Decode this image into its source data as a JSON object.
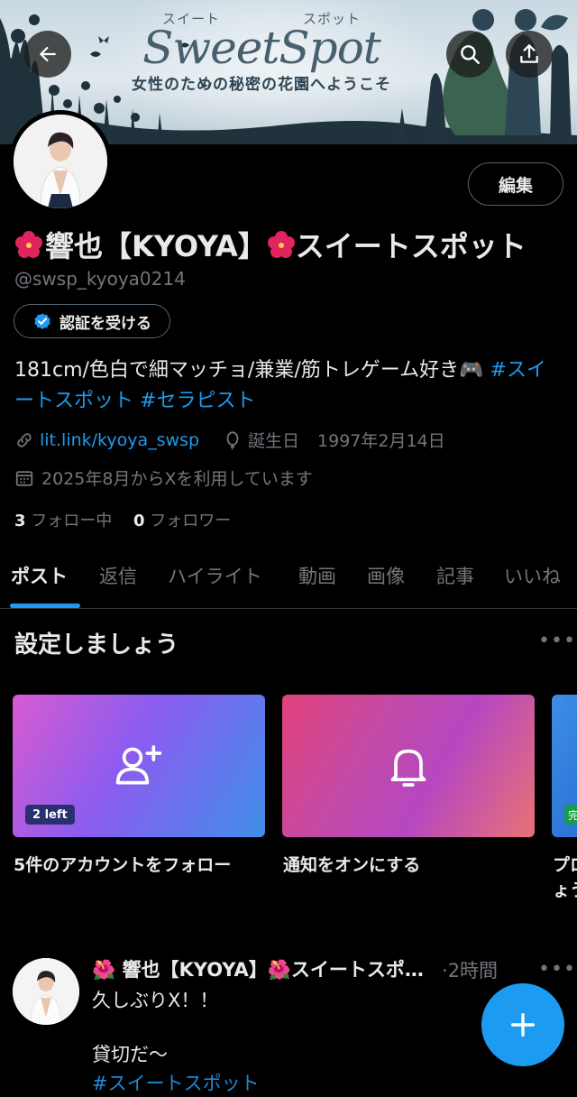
{
  "banner": {
    "logo_kana_left": "スイート",
    "logo_kana_right": "スポット",
    "logo_main": "SweetSpot",
    "tagline": "女性のための秘密の花園へようこそ"
  },
  "nav": {
    "back_icon": "arrow-left-icon",
    "search_icon": "search-icon",
    "share_icon": "share-upload-icon"
  },
  "profile": {
    "edit_label": "編集",
    "name_emoji": "🌺",
    "name_text": "響也【KYOYA】",
    "name_suffix": "スイートスポット",
    "handle": "@swsp_kyoya0214",
    "verify_label": "認証を受ける",
    "bio_text": "181cm/色白で細マッチョ/兼業/筋トレゲーム好き🎮 ",
    "bio_tag1": "#スイートスポット",
    "bio_tag2": "#セラピスト",
    "link": "lit.link/kyoya_swsp",
    "birthday_label": "誕生日",
    "birthday": "1997年2月14日",
    "joined": "2025年8月からXを利用しています",
    "following_count": "3",
    "following_label": "フォロー中",
    "followers_count": "0",
    "followers_label": "フォロワー"
  },
  "tabs": [
    {
      "label": "ポスト",
      "active": true
    },
    {
      "label": "返信"
    },
    {
      "label": "ハイライト"
    },
    {
      "label": "動画"
    },
    {
      "label": "画像"
    },
    {
      "label": "記事"
    },
    {
      "label": "いいね"
    }
  ],
  "setup": {
    "title": "設定しましょう",
    "cards": [
      {
        "label": "5件のアカウントをフォロー",
        "badge": "2 left",
        "icon": "add-person-icon"
      },
      {
        "label": "通知をオンにする",
        "icon": "bell-icon"
      },
      {
        "label": "プロ",
        "label2": "ょう",
        "badge": "完",
        "icon": ""
      }
    ]
  },
  "post": {
    "name": "🌺 響也【KYOYA】🌺スイートスポ…",
    "separator": "·",
    "time": "2時間",
    "line1": "久しぶりX！！",
    "line2": "貸切だ〜",
    "line3": "#スイートスポット"
  },
  "fab_icon": "plus-icon",
  "colors": {
    "accent": "#1d9bf0",
    "background": "#000000",
    "text": "#e7e9ea",
    "muted": "#71767b"
  }
}
